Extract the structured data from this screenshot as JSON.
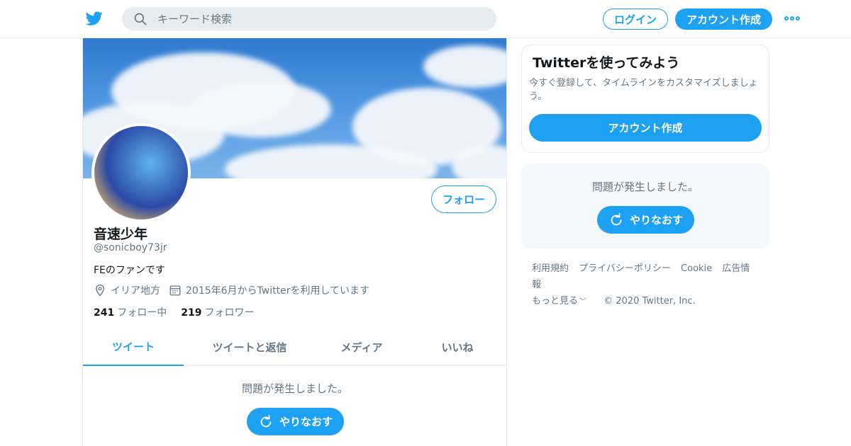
{
  "header": {
    "search_placeholder": "キーワード検索",
    "login_label": "ログイン",
    "signup_label": "アカウント作成",
    "brand_color": "#1da1f2"
  },
  "profile": {
    "display_name": "音速少年",
    "handle": "@sonicboy73jr",
    "bio": "FEのファンです",
    "location": "イリア地方",
    "joined": "2015年6月からTwitterを利用しています",
    "following_count": "241",
    "following_label": "フォロー中",
    "followers_count": "219",
    "followers_label": "フォロワー",
    "follow_button": "フォロー"
  },
  "tabs": [
    {
      "label": "ツイート",
      "active": true
    },
    {
      "label": "ツイートと返信",
      "active": false
    },
    {
      "label": "メディア",
      "active": false
    },
    {
      "label": "いいね",
      "active": false
    }
  ],
  "timeline_error": {
    "message": "問題が発生しました。",
    "retry_label": "やりなおす"
  },
  "signup_card": {
    "title": "Twitterを使ってみよう",
    "description": "今すぐ登録して、タイムラインをカスタマイズしましょう。",
    "button": "アカウント作成"
  },
  "side_error": {
    "message": "問題が発生しました。",
    "retry_label": "やりなおす"
  },
  "footer": {
    "links": [
      "利用規約",
      "プライバシーポリシー",
      "Cookie",
      "広告情報"
    ],
    "more": "もっと見る",
    "copyright": "© 2020 Twitter, Inc."
  }
}
